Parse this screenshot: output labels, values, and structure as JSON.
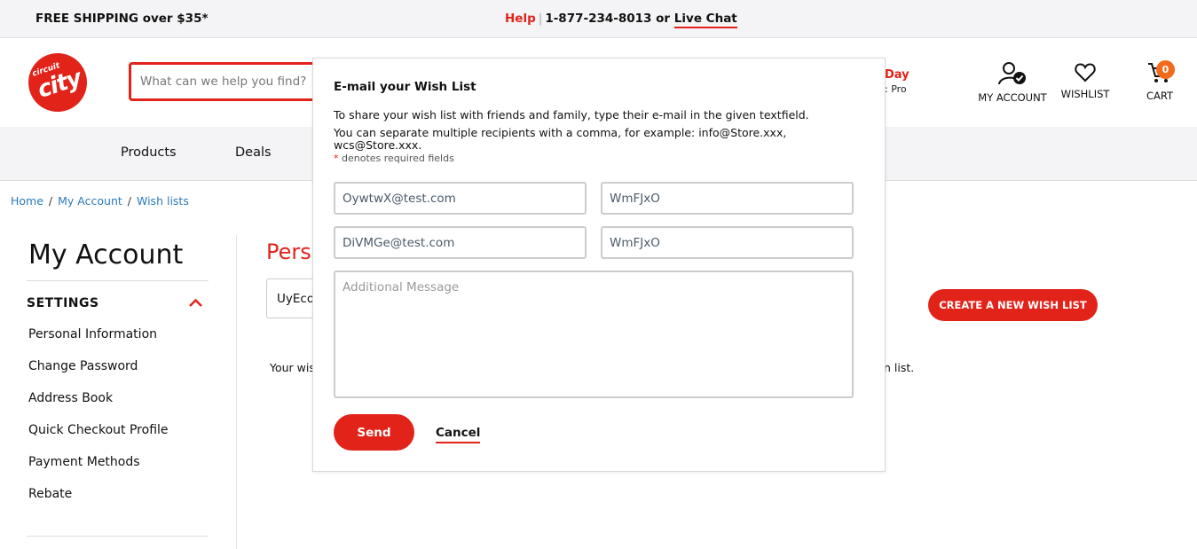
{
  "topbar": {
    "shipping": "FREE SHIPPING over $35*",
    "help": "Help",
    "separator": "|",
    "phone_text": "1-877-234-8013 or",
    "live_chat": "Live Chat"
  },
  "header": {
    "logo": {
      "line1": "circuit",
      "line2": "city"
    },
    "search_placeholder": "What can we help you find?",
    "promo_title": "Day",
    "promo_sub": ": Pro",
    "account_label": "MY ACCOUNT",
    "wishlist_label": "WISHLIST",
    "cart_label": "CART",
    "cart_count": "0"
  },
  "nav": {
    "items": [
      "Products",
      "Deals"
    ]
  },
  "breadcrumb": {
    "items": [
      "Home",
      "My Account",
      "Wish lists"
    ],
    "separator": "/"
  },
  "sidebar": {
    "title": "My Account",
    "section": "SETTINGS",
    "links": [
      "Personal Information",
      "Change Password",
      "Address Book",
      "Quick Checkout Profile",
      "Payment Methods",
      "Rebate"
    ]
  },
  "main": {
    "title_fragment": "Pers",
    "select_fragment": "UyEco",
    "create_button": "CREATE A NEW WISH LIST",
    "empty_left": "Your wis",
    "empty_right": "n list."
  },
  "modal": {
    "title": "E-mail your Wish List",
    "desc1": "To share your wish list with friends and family, type their e-mail in the given textfield.",
    "desc2": "You can separate multiple recipients with a comma, for example: info@Store.xxx, wcs@Store.xxx.",
    "req_star": "*",
    "req_text": "denotes required fields",
    "email1": "OywtwX@test.com",
    "name1": "WmFJxO",
    "email2": "DiVMGe@test.com",
    "name2": "WmFJxO",
    "message_placeholder": "Additional Message",
    "send": "Send",
    "cancel": "Cancel"
  },
  "colors": {
    "accent": "#e2231a",
    "badge": "#f26a1b",
    "link": "#2a7ab8"
  }
}
